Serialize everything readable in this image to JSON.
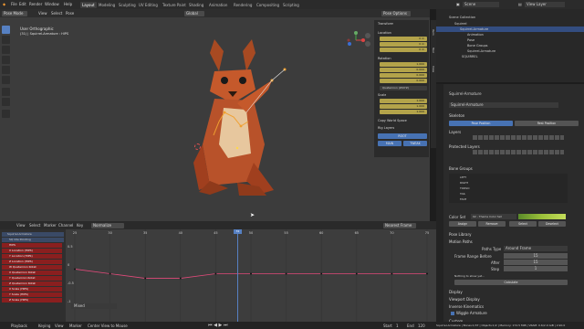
{
  "menubar": {
    "items": [
      "File",
      "Edit",
      "Render",
      "Window",
      "Help"
    ],
    "workspaces": [
      "Layout",
      "Modeling",
      "Sculpting",
      "UV Editing",
      "Texture Paint",
      "Shading",
      "Animation",
      "Rendering",
      "Compositing",
      "Scripting"
    ],
    "scene": "Scene",
    "view_layer": "View Layer"
  },
  "viewport": {
    "mode": "Pose Mode",
    "menus": [
      "View",
      "Select",
      "Pose"
    ],
    "orientation": "Global",
    "title": "User Orthographic",
    "subtitle": "(31) | Squirrel-Armature : HIPS",
    "pose_options": "Pose Options"
  },
  "npanel": {
    "transform_title": "Transform",
    "location_label": "Location",
    "location": [
      "0 m",
      "0 m",
      "0 m"
    ],
    "rotation_label": "Rotation",
    "rotation": [
      "1.000",
      "0.000",
      "0.000",
      "0.000"
    ],
    "rotation_mode": "Quaternion (WXYZ)",
    "scale_label": "Scale",
    "scale": [
      "1.000",
      "1.000",
      "1.000"
    ],
    "copy_world": "Copy World Space",
    "rig_layers": "Rig Layers",
    "buttons": [
      "ROOT",
      "MAIN",
      "TWEAK"
    ],
    "tabs": [
      "Item",
      "Tool",
      "View"
    ]
  },
  "outliner": {
    "title": "Scene Collection",
    "rows": [
      "Squirrel",
      "Squirrel-Armature",
      "Animation",
      "Pose",
      "Bone Groups",
      "Squirrel-Armature",
      "SQUIRREL"
    ]
  },
  "props": {
    "object": "Squirrel-Armature",
    "data": "Squirrel-Armature",
    "skeleton": "Skeleton",
    "pose_position": "Pose Position",
    "rest_position": "Rest Position",
    "layers": "Layers",
    "protected_layers": "Protected Layers",
    "bone_groups": "Bone Groups",
    "groups": [
      "LEFT",
      "RIGHT",
      "TORSO",
      "TAIL",
      "FACE"
    ],
    "color_set_label": "Color Set",
    "color_set": "02 - Theme Color Set",
    "group_buttons": [
      "Assign",
      "Remove",
      "Select",
      "Deselect"
    ],
    "pose_library": "Pose Library",
    "motion_paths": "Motion Paths",
    "paths_type_label": "Paths Type",
    "paths_type": "Around Frame",
    "frame_range_before_label": "Frame Range Before",
    "frame_range_before": "15",
    "after_label": "After",
    "after": "15",
    "step_label": "Step",
    "step": "1",
    "nothing_note": "Nothing to show yet...",
    "calculate": "Calculate",
    "display": "Display",
    "viewport_display": "Viewport Display",
    "inverse_kinematics": "Inverse Kinematics",
    "wiggle": "Wiggle Armature",
    "custom_props": "Custom"
  },
  "graph": {
    "menus": [
      "View",
      "Select",
      "Marker",
      "Channel",
      "Key"
    ],
    "mode": "Normalize",
    "pivot": "Nearest Frame",
    "frames": [
      "25",
      "30",
      "35",
      "40",
      "45",
      "50",
      "55",
      "60",
      "65",
      "70",
      "75"
    ],
    "current_frame": "31",
    "armature": "Squirrel-Armature",
    "action": "SQ Idle Pointing",
    "channels": [
      "HIPS",
      "X Location (HIPS)",
      "Y Location (HIPS)",
      "Z Location (HIPS)",
      "W Quaternion Rotat",
      "X Quaternion Rotat",
      "Y Quaternion Rotat",
      "Z Quaternion Rotat",
      "X Scale (HIPS)",
      "Y Scale (HIPS)",
      "Z Scale (HIPS)"
    ],
    "more": "Mixed",
    "ylabels": [
      "0.5",
      "0",
      "-0.5",
      "-1"
    ],
    "curve_red": [
      0.55,
      0.5,
      0.45,
      0.45,
      0.5,
      0.5,
      0.5,
      0.5,
      0.5,
      0.5,
      0.5
    ]
  },
  "statusbar": {
    "playback": "Playback",
    "keying": "Keying",
    "view": "View",
    "marker": "Marker",
    "start_label": "Start",
    "start": "1",
    "end_label": "End",
    "end": "120",
    "hint": "Center View to Mouse",
    "info": "Squirrel-Armature | Bones:1/37 | Objects:1/2 | Memory: 172.5 MiB | VRAM: 0.6/2.0 GiB | 2.90.0"
  },
  "colors": {
    "accent": "#4772b3",
    "squirrel_orange": "#c5592b",
    "squirrel_cream": "#e7c79e",
    "channel_red": "#8a1f1f",
    "frame_marker": "#5680c2"
  }
}
